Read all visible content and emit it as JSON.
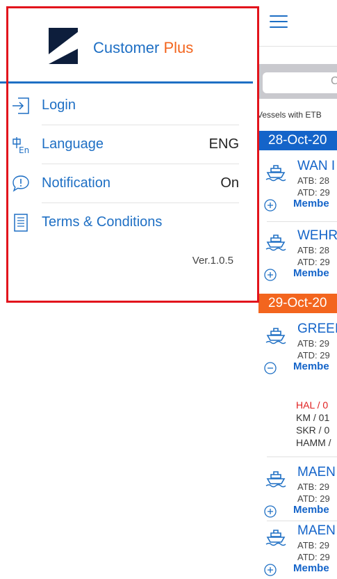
{
  "drawer": {
    "brand": {
      "name": "Customer",
      "accent": "Plus"
    },
    "menu": [
      {
        "label": "Login",
        "value": ""
      },
      {
        "label": "Language",
        "value": "ENG"
      },
      {
        "label": "Notification",
        "value": "On"
      },
      {
        "label": "Terms & Conditions",
        "value": ""
      }
    ],
    "version": "Ver.1.0.5"
  },
  "background": {
    "search_glyph": "C",
    "vessel_note": "Vessels with ETB",
    "dates": [
      "28-Oct-20",
      "29-Oct-20"
    ],
    "vessels": [
      {
        "name": "WAN I",
        "atb": "ATB: 28",
        "atd": "ATD: 29",
        "member": "Membe",
        "expanded": false
      },
      {
        "name": "WEHR",
        "atb": "ATB: 28",
        "atd": "ATD: 29",
        "member": "Membe",
        "expanded": false
      },
      {
        "name": "GREEI",
        "atb": "ATB: 29",
        "atd": "ATD: 29",
        "member": "Membe",
        "expanded": true
      },
      {
        "name": "MAEN",
        "atb": "ATB: 29",
        "atd": "ATD: 29",
        "member": "Membe",
        "expanded": false
      },
      {
        "name": "MAEN",
        "atb": "ATB: 29",
        "atd": "ATD: 29",
        "member": "Membe",
        "expanded": false
      }
    ],
    "details": [
      "HAL / 0",
      "KM / 01",
      "SKR / 0",
      "HAMM /"
    ]
  },
  "colors": {
    "primary_blue": "#1e6fc4",
    "date_blue": "#1464c9",
    "date_orange": "#f3651e",
    "highlight_red": "#e2141c",
    "detail_red": "#e02020"
  }
}
